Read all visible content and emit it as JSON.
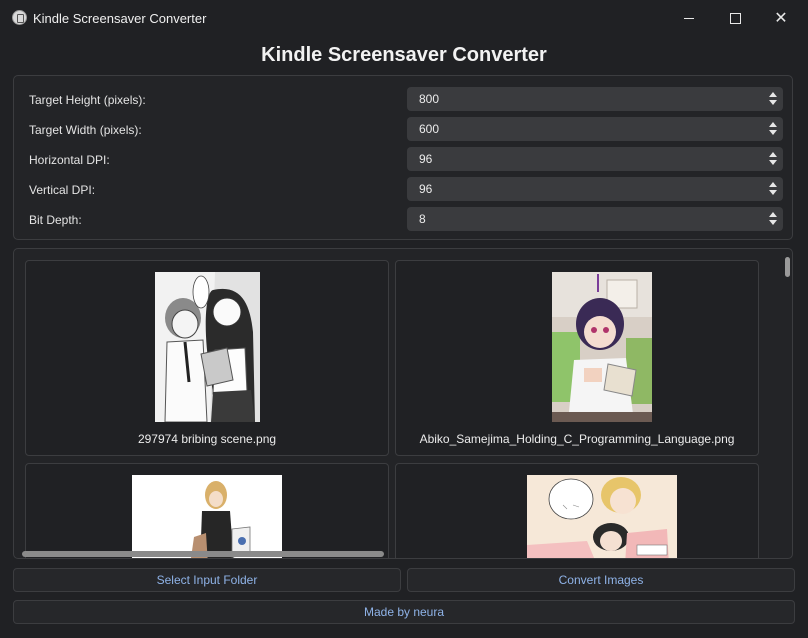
{
  "window": {
    "title": "Kindle Screensaver Converter",
    "icon": "app-icon"
  },
  "heading": "Kindle Screensaver Converter",
  "settings": [
    {
      "label": "Target Height (pixels):",
      "value": "800"
    },
    {
      "label": "Target Width (pixels):",
      "value": "600"
    },
    {
      "label": "Horizontal DPI:",
      "value": "96"
    },
    {
      "label": "Vertical DPI:",
      "value": "96"
    },
    {
      "label": "Bit Depth:",
      "value": "8"
    }
  ],
  "gallery": {
    "items": [
      {
        "filename": "297974 bribing scene.png"
      },
      {
        "filename": "Abiko_Samejima_Holding_C_Programming_Language.png"
      },
      {
        "filename": ""
      },
      {
        "filename": ""
      }
    ]
  },
  "buttons": {
    "select_input": "Select Input Folder",
    "convert": "Convert Images",
    "credit": "Made by neura"
  },
  "colors": {
    "background": "#202124",
    "accent_text": "#8fb3e8",
    "border": "#3c3d40"
  }
}
